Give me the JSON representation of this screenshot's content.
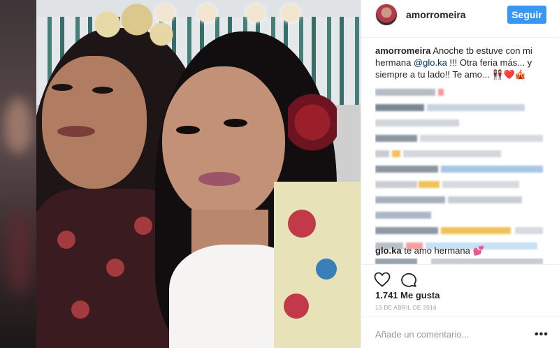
{
  "post": {
    "username": "amorromeira",
    "follow_label": "Seguir",
    "caption_user": "amorromeira",
    "caption_text_1": "Anoche tb estuve con mi hermana ",
    "caption_mention": "@glo.ka",
    "caption_text_2": " !!! Otra feria más... y siempre a tu lado!! Te amo... 👭❤️🎪",
    "reply_user": "glo.ka",
    "reply_text": "te amo hermana 💕",
    "likes": "1.741 Me gusta",
    "date": "13 DE ABRIL DE 2016",
    "comment_placeholder": "Añade un comentario...",
    "more_label": "•••"
  },
  "colors": {
    "follow_button": "#3897f0",
    "mention": "#003569",
    "meta_gray": "#999999"
  },
  "icons": [
    "heart-icon",
    "comment-icon",
    "more-options-icon",
    "avatar"
  ]
}
